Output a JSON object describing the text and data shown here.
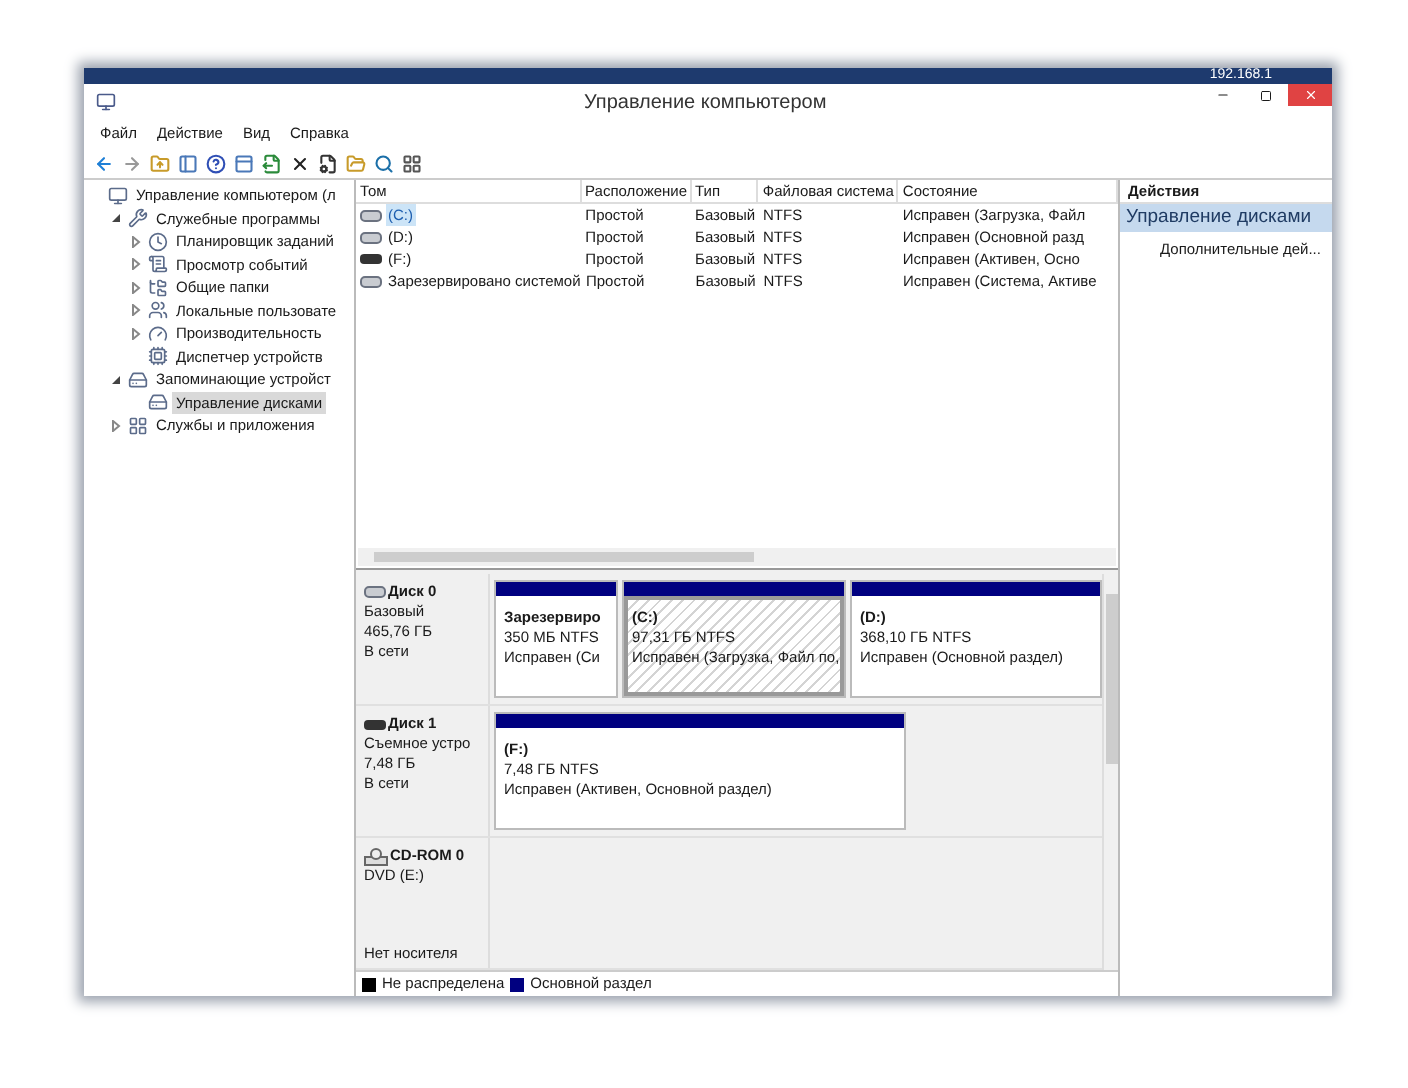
{
  "remote_bar": {
    "address": "192.168.1"
  },
  "window": {
    "title": "Управление компьютером"
  },
  "menu": [
    "Файл",
    "Действие",
    "Вид",
    "Справка"
  ],
  "tree": [
    {
      "kind": "root",
      "label": "Управление компьютером (л",
      "selected": false,
      "children": [
        {
          "kind": "node",
          "label": "Служебные программы",
          "expanded": true,
          "selected": false,
          "children": [
            {
              "kind": "node",
              "label": "Планировщик заданий",
              "expanded": false,
              "selected": false
            },
            {
              "kind": "node",
              "label": "Просмотр событий",
              "expanded": false,
              "selected": false
            },
            {
              "kind": "node",
              "label": "Общие папки",
              "expanded": false,
              "selected": false
            },
            {
              "kind": "node",
              "label": "Локальные пользовате",
              "expanded": false,
              "selected": false
            },
            {
              "kind": "node",
              "label": "Производительность",
              "expanded": false,
              "selected": false
            },
            {
              "kind": "leaf",
              "label": "Диспетчер устройств",
              "selected": false
            }
          ]
        },
        {
          "kind": "node",
          "label": "Запоминающие устройст",
          "expanded": true,
          "selected": false,
          "children": [
            {
              "kind": "leaf",
              "label": "Управление дисками",
              "selected": true
            }
          ]
        },
        {
          "kind": "node",
          "label": "Службы и приложения",
          "expanded": false,
          "selected": false
        }
      ]
    }
  ],
  "volumes": {
    "columns": [
      "Том",
      "Расположение",
      "Тип",
      "Файловая система",
      "Состояние"
    ],
    "rows": [
      {
        "kind": "hdd",
        "name": "(C:)",
        "layout": "Простой",
        "type": "Базовый",
        "fs": "NTFS",
        "status": "Исправен (Загрузка, Файл",
        "selected": true
      },
      {
        "kind": "hdd",
        "name": "(D:)",
        "layout": "Простой",
        "type": "Базовый",
        "fs": "NTFS",
        "status": "Исправен (Основной разд",
        "selected": false
      },
      {
        "kind": "usb",
        "name": "(F:)",
        "layout": "Простой",
        "type": "Базовый",
        "fs": "NTFS",
        "status": "Исправен (Активен, Осно",
        "selected": false
      },
      {
        "kind": "hdd",
        "name": "Зарезервировано системой",
        "layout": "Простой",
        "type": "Базовый",
        "fs": "NTFS",
        "status": "Исправен (Система, Активе",
        "selected": false
      }
    ]
  },
  "disks": [
    {
      "kind": "hdd",
      "name": "Диск 0",
      "lines": [
        "Базовый",
        "465,76 ГБ",
        "В сети"
      ],
      "partitions": [
        {
          "kind": "primary",
          "name": "Зарезервиро",
          "size": "350 МБ NTFS",
          "status": "Исправен (Си",
          "selected": false
        },
        {
          "kind": "primary",
          "name": "(C:)",
          "size": "97,31 ГБ NTFS",
          "status": "Исправен (Загрузка, Файл по,",
          "selected": true
        },
        {
          "kind": "primary",
          "name": "(D:)",
          "size": "368,10 ГБ NTFS",
          "status": "Исправен (Основной раздел)",
          "selected": false
        }
      ]
    },
    {
      "kind": "usb",
      "name": "Диск 1",
      "lines": [
        "Съемное устро",
        "7,48 ГБ",
        "В сети"
      ],
      "partitions": [
        {
          "kind": "primary",
          "name": "(F:)",
          "size": "7,48 ГБ NTFS",
          "status": "Исправен (Активен, Основной раздел)",
          "selected": false
        }
      ]
    },
    {
      "kind": "cdrom",
      "name": "CD-ROM 0",
      "lines": [
        "DVD (E:)"
      ],
      "note": "Нет носителя"
    }
  ],
  "legend": [
    {
      "label": "Не распределена",
      "color": "#000000"
    },
    {
      "label": "Основной раздел",
      "color": "#000080"
    }
  ],
  "actions": {
    "header": "Действия",
    "section": "Управление дисками",
    "items": [
      "Дополнительные дей..."
    ]
  }
}
